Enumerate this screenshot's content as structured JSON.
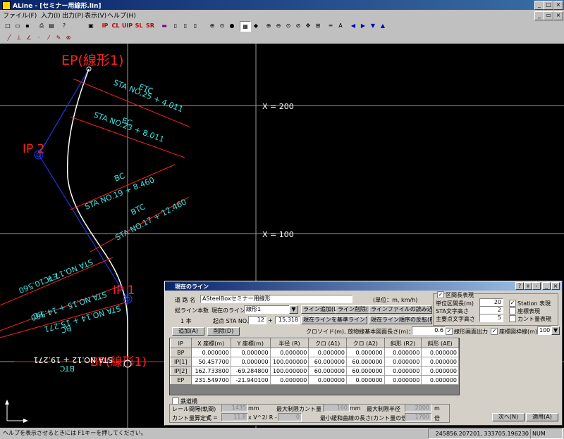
{
  "window": {
    "title": "ALine - [セミナー用線形.lin]"
  },
  "menu": [
    "ファイル(F)",
    "入力(I)",
    "出力(P)",
    "表示(V)",
    "ヘルプ(H)"
  ],
  "toolbar": {
    "buttons": [
      "IP",
      "CL",
      "UIP",
      "SL",
      "SR"
    ]
  },
  "canvas": {
    "grid_labels": [
      "X = 200",
      "X = 100"
    ],
    "points": [
      "EP(線形1)",
      "IP 2",
      "IP 1",
      "BP(線形1)"
    ],
    "stations": [
      {
        "code": "ETC",
        "sta": "STA NO.25 + 4.011"
      },
      {
        "code": "EC",
        "sta": "STA NO.23 + 8.011"
      },
      {
        "code": "BC",
        "sta": "STA NO.19 + 8.460"
      },
      {
        "code": "BTC",
        "sta": "STA NO.17 + 12.460"
      },
      {
        "code": "ETC",
        "sta": "STA NO.17 + 10.560"
      },
      {
        "code": "EC",
        "sta": "STA NO.15 + 14.560"
      },
      {
        "code": "BC",
        "sta": "STA NO.14 + 15.271"
      },
      {
        "code": "BTC",
        "sta": "STA NO.12 + 19.271"
      }
    ]
  },
  "dialog": {
    "title": "現在のライン",
    "route_name_label": "道 路 名",
    "route_name": "ASteelBoxセミナー用線形",
    "unit": "(単位：m, km/h)",
    "total_lines_label": "総ライン本数",
    "total_lines": "1 本",
    "current_line_label": "現在のライン",
    "current_line": "線形1",
    "start_sta_label": "起点 STA NO.",
    "start_sta_no": "12",
    "start_sta_plus": "+",
    "start_sta_offset": "15.318",
    "btn_add_line": "ライン追加(L)",
    "btn_delete_line": "ライン削除(E)",
    "btn_load_file": "ラインファイルの読み込み",
    "btn_set_base": "現在ラインを基準ラインで",
    "btn_reverse": "現在ライン順序の反転(R)",
    "btn_add": "追加(A)",
    "btn_delete": "削除(D)",
    "clothoid_label": "クロソイド(m), 放物線基本図面長さ(m)：",
    "clothoid_value": "0.6",
    "chk_line_screen_out": "線形画面出力",
    "chk_coord_frame": "座標図枠線(m)",
    "frame_value": "100",
    "interval_display": {
      "label": "区間長表現",
      "unit_interval_label": "単位区間長(m)",
      "unit_interval": "20",
      "sta_char_label": "STA文字高さ",
      "sta_char": "2",
      "main_point_char_label": "主要点文字高さ",
      "main_point_char": "5",
      "chk_station": "Station 表現",
      "chk_coord": "座標表現",
      "chk_cant": "カント量表現"
    },
    "table": {
      "headers": [
        "IP",
        "X 座標(m)",
        "Y 座標(m)",
        "半径 (R)",
        "クロ (A1)",
        "クロ (A2)",
        "斜形 (R2)",
        "斜形 (AE)"
      ],
      "rows": [
        [
          "BP",
          "0.000000",
          "0.000000",
          "0.000000",
          "0.000000",
          "0.000000",
          "0.000000",
          "0.000000"
        ],
        [
          "IP[1]",
          "50.457700",
          "0.000000",
          "100.000000",
          "60.000000",
          "60.000000",
          "0.000000",
          "0.000000"
        ],
        [
          "IP[2]",
          "162.733800",
          "-69.284800",
          "100.000000",
          "60.000000",
          "60.000000",
          "0.000000",
          "0.000000"
        ],
        [
          "EP",
          "231.549700",
          "-21.940100",
          "0.000000",
          "0.000000",
          "0.000000",
          "0.000000",
          "0.000000"
        ]
      ]
    },
    "rail": {
      "chk_label": "鉄道橋",
      "gauge_label": "レール間隔(軌間)",
      "gauge": "1435",
      "gauge_unit": "mm",
      "max_cant_label": "最大制限カント量",
      "max_cant": "160",
      "max_cant_unit": "mm",
      "min_radius_label": "最大制限半径",
      "min_radius": "2000",
      "min_radius_unit": "m",
      "cant_formula_label": "カント量算定式",
      "c_label": "C =",
      "c_value": "11.8",
      "formula": "x V^2/ R -",
      "formula_value": "0",
      "min_transition_label": "最小緩和曲線の長さ(カント量の倍数)",
      "min_transition": "1700",
      "min_transition_unit": "倍"
    },
    "btn_next": "次へ(N)",
    "btn_apply": "適用(A)"
  },
  "status": {
    "help": "ヘルプを表示させるときには F1キーを押してください。",
    "coords": "245856.207201, 333705.196230",
    "num": "NUM"
  },
  "colors": {
    "canvas_bg": "#000000",
    "red": "#ff2020",
    "cyan": "#40e0e0",
    "blue": "#2040ff",
    "white": "#ffffff"
  }
}
